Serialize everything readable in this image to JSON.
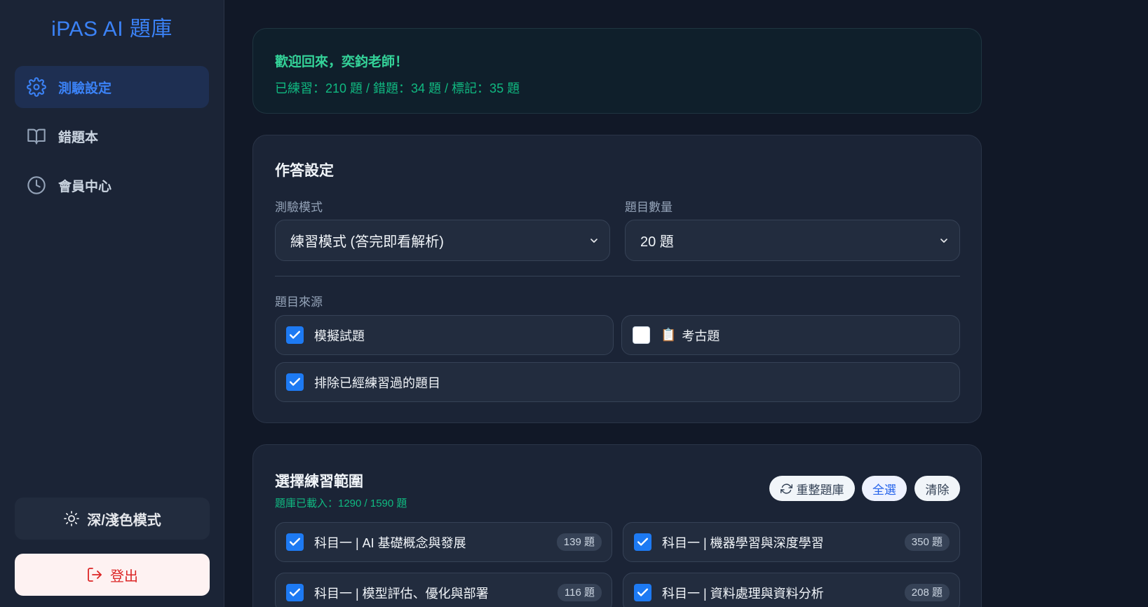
{
  "brand": "iPAS AI 題庫",
  "nav": [
    {
      "label": "測驗設定",
      "icon": "gear-icon",
      "active": true
    },
    {
      "label": "錯題本",
      "icon": "book-icon",
      "active": false
    },
    {
      "label": "會員中心",
      "icon": "clock-icon",
      "active": false
    }
  ],
  "theme_toggle": {
    "label": "深/淺色模式",
    "icon": "sun-icon"
  },
  "logout": {
    "label": "登出",
    "icon": "logout-icon"
  },
  "welcome": {
    "greeting": "歡迎回來，奕鈞老師！",
    "stats": "已練習：210 題 / 錯題：34 題 / 標記：35 題"
  },
  "settings": {
    "title": "作答設定",
    "mode_label": "測驗模式",
    "mode_value": "練習模式 (答完即看解析)",
    "count_label": "題目數量",
    "count_value": "20 題",
    "source_label": "題目來源",
    "sources": [
      {
        "label": "模擬試題",
        "checked": true
      },
      {
        "label": "考古題",
        "checked": false,
        "icon": "📋"
      }
    ],
    "exclude": {
      "label": "排除已經練習過的題目",
      "checked": true
    }
  },
  "range": {
    "title": "選擇練習範圍",
    "loaded": "題庫已載入：1290 / 1590 題",
    "reload_label": "重整題庫",
    "select_all_label": "全選",
    "clear_label": "清除",
    "subjects": [
      {
        "label": "科目一 | AI 基礎概念與發展",
        "count": "139 題",
        "checked": true
      },
      {
        "label": "科目一 | 機器學習與深度學習",
        "count": "350 題",
        "checked": true
      },
      {
        "label": "科目一 | 模型評估、優化與部署",
        "count": "116 題",
        "checked": true
      },
      {
        "label": "科目一 | 資料處理與資料分析",
        "count": "208 題",
        "checked": true
      }
    ]
  }
}
